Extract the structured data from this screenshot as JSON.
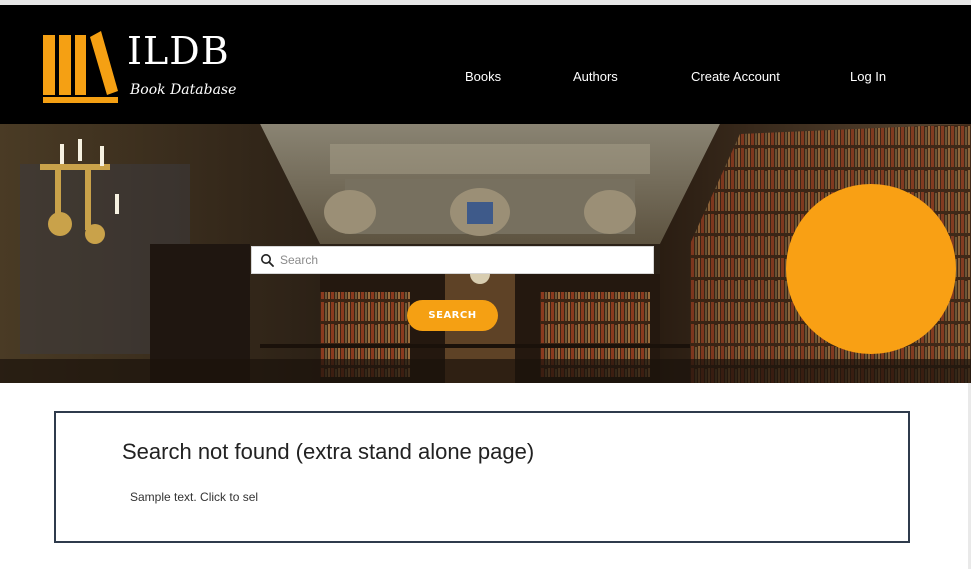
{
  "header": {
    "brand_name": "ILDB",
    "brand_tagline": "Book Database",
    "nav": [
      {
        "label": "Books"
      },
      {
        "label": "Authors"
      },
      {
        "label": "Create Account"
      },
      {
        "label": "Log In"
      }
    ]
  },
  "hero": {
    "search_placeholder": "Search",
    "search_value": "",
    "search_button": "SEARCH"
  },
  "main": {
    "title": "Search not found (extra stand alone page)",
    "body_text": "Sample text. Click to sel"
  },
  "icons": [
    "books-logo-icon",
    "search-icon"
  ],
  "colors": {
    "accent": "#f9a014",
    "header_bg": "#000000",
    "box_border": "#2f3b4c"
  }
}
